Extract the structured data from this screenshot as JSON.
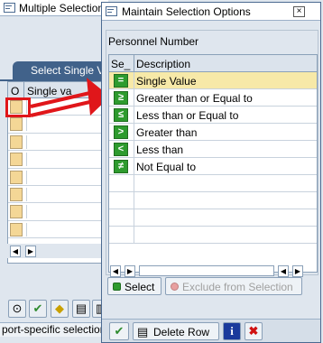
{
  "background": {
    "title": "Multiple Selection",
    "tab_label": "Select Single Values",
    "table_headers": {
      "col1": "O",
      "col2": "Single va"
    },
    "rows": 8,
    "status_text": "port-specific selection"
  },
  "dialog": {
    "title": "Maintain Selection Options",
    "close_glyph": "×",
    "group_label": "Personnel Number",
    "table": {
      "col_sign": "Se_",
      "col_desc": "Description",
      "rows": [
        {
          "glyph": "=",
          "label": "Single Value",
          "selected": true
        },
        {
          "glyph": "≥",
          "label": "Greater than or Equal to",
          "selected": false
        },
        {
          "glyph": "≤",
          "label": "Less than or Equal to",
          "selected": false
        },
        {
          "glyph": ">",
          "label": "Greater than",
          "selected": false
        },
        {
          "glyph": "<",
          "label": "Less than",
          "selected": false
        },
        {
          "glyph": "≠",
          "label": "Not Equal to",
          "selected": false
        }
      ]
    },
    "buttons": {
      "select": "Select",
      "exclude": "Exclude from Selection",
      "delete_row": "Delete Row"
    }
  },
  "colors": {
    "highlight": "#e0161a",
    "selected_row": "#f7e9a8",
    "sign_icon": "#2e9b2e"
  }
}
